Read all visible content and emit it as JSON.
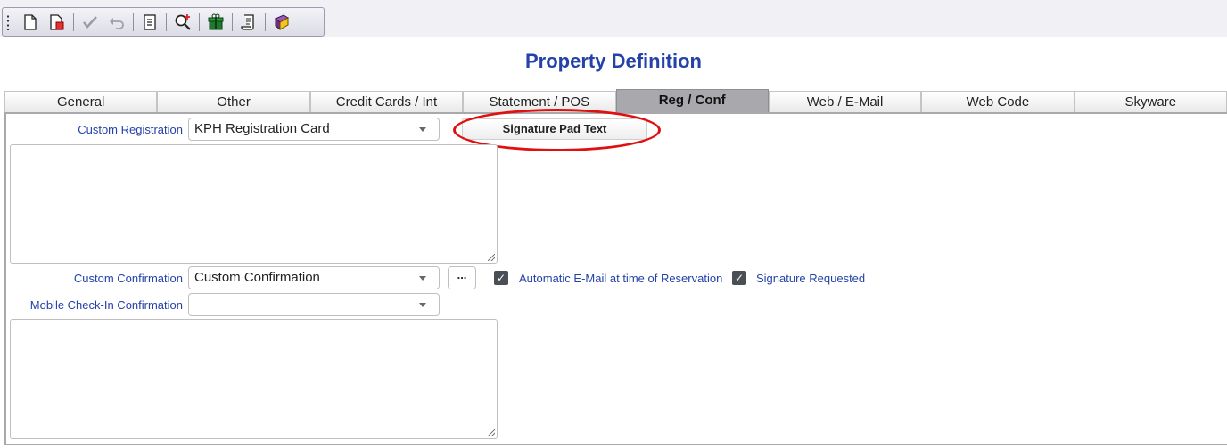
{
  "toolbar": {
    "icons": [
      "new-document-icon",
      "delete-document-icon",
      "save-check-icon",
      "undo-icon",
      "report-icon",
      "search-add-icon",
      "gift-icon",
      "scroll-icon",
      "book-icon"
    ]
  },
  "page": {
    "title": "Property Definition"
  },
  "tabs": [
    {
      "label": "General",
      "active": false
    },
    {
      "label": "Other",
      "active": false
    },
    {
      "label": "Credit Cards / Int",
      "active": false
    },
    {
      "label": "Statement / POS",
      "active": false
    },
    {
      "label": "Reg / Conf",
      "active": true
    },
    {
      "label": "Web / E-Mail",
      "active": false
    },
    {
      "label": "Web Code",
      "active": false
    },
    {
      "label": "Skyware",
      "active": false
    }
  ],
  "form": {
    "custom_registration": {
      "label": "Custom Registration",
      "value": "KPH Registration Card"
    },
    "signature_pad_button": "Signature Pad Text",
    "custom_confirmation": {
      "label": "Custom Confirmation",
      "value": "Custom Confirmation"
    },
    "dots_button": "...",
    "auto_email": {
      "label": "Automatic E-Mail at time of Reservation",
      "checked": true
    },
    "signature_requested": {
      "label": "Signature Requested",
      "checked": true
    },
    "mobile_checkin": {
      "label": "Mobile Check-In Confirmation",
      "value": ""
    }
  },
  "colors": {
    "accent": "#2442a8",
    "highlight": "#e01010",
    "active_tab": "#a9a9ad"
  }
}
